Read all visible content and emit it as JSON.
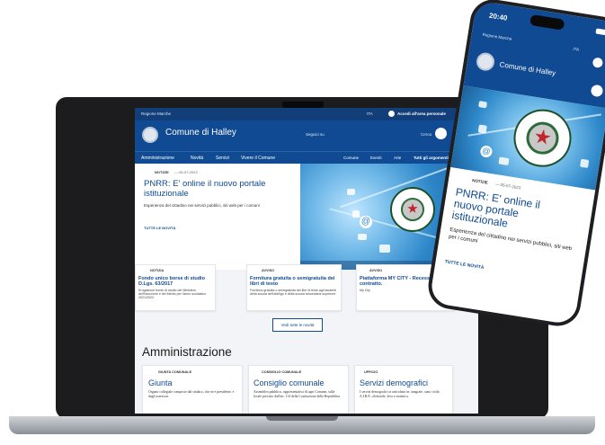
{
  "laptop": {
    "slim_header": {
      "region": "Regione Marche",
      "lang": "ITA",
      "login": "Accedi all'area personale"
    },
    "header": {
      "title": "Comune di Halley",
      "follow": "Seguici su",
      "search": "Cerca"
    },
    "nav": {
      "left": [
        "Amministrazione",
        "Novità",
        "Servizi",
        "Vivere il Comune"
      ],
      "right": [
        "Comune",
        "Eventi",
        "Arte",
        "Tutti gli argomenti"
      ]
    },
    "hero": {
      "category": "NOTIZIE",
      "date": "— 05-07-2023",
      "title": "PNRR: E' online il nuovo portale istituzionale",
      "text": "Esperienza del cittadino nei servizi pubblici, siti web per i comuni",
      "link": "TUTTE LE NOVITÀ"
    },
    "news_cards": [
      {
        "category": "NOTIZIA",
        "title": "Fondo unico borse di studio D.Lgs. 63/2017",
        "text": "Erogazione borse di studio del Ministero dell'Istruzione e del Merito per l'anno scolastico 2021/2022."
      },
      {
        "category": "AVVISO",
        "title": "Fornitura gratuita o semigratuita dei libri di testo",
        "text": "Fornitura gratuita o semigratuita dei libri di testo agli studenti della scuola dell'obbligo e della scuola secondaria superiore"
      },
      {
        "category": "AVVISO",
        "title": "Piattaforma MY CITY - Recesso dal contratto.",
        "text": "My City"
      }
    ],
    "see_all": "Vedi tutte le novità",
    "admin_heading": "Amministrazione",
    "admin_cards": [
      {
        "category": "GIUNTA COMUNALE",
        "title": "Giunta",
        "text": "Organo collegiale composto dal sindaco, che ne è presidente, e dagli assessori."
      },
      {
        "category": "CONSIGLIO COMUNALE",
        "title": "Consiglio comunale",
        "text": "Assemblea pubblica, rappresentativa di ogni Comune, sulla locale previsto dall'art. 114 della Costituzione della Repubblica"
      },
      {
        "category": "UFFICIO",
        "title": "Servizi demografici",
        "text": "I servizi demografici si articolano in: anagrafe, stato civile, A.I.R.E., elettorale, leva e statistica."
      }
    ]
  },
  "phone": {
    "status_time": "20:40",
    "region": "Regione Marche",
    "lang": "ITA",
    "title": "Comune di Halley",
    "category": "NOTIZIE",
    "date": "— 05-07-2023",
    "headline": "PNRR: E' online il nuovo portale istituzionale",
    "text": "Esperienza del cittadino nei servizi pubblici, siti web per i comuni",
    "link": "TUTTE LE NOVITÀ"
  }
}
